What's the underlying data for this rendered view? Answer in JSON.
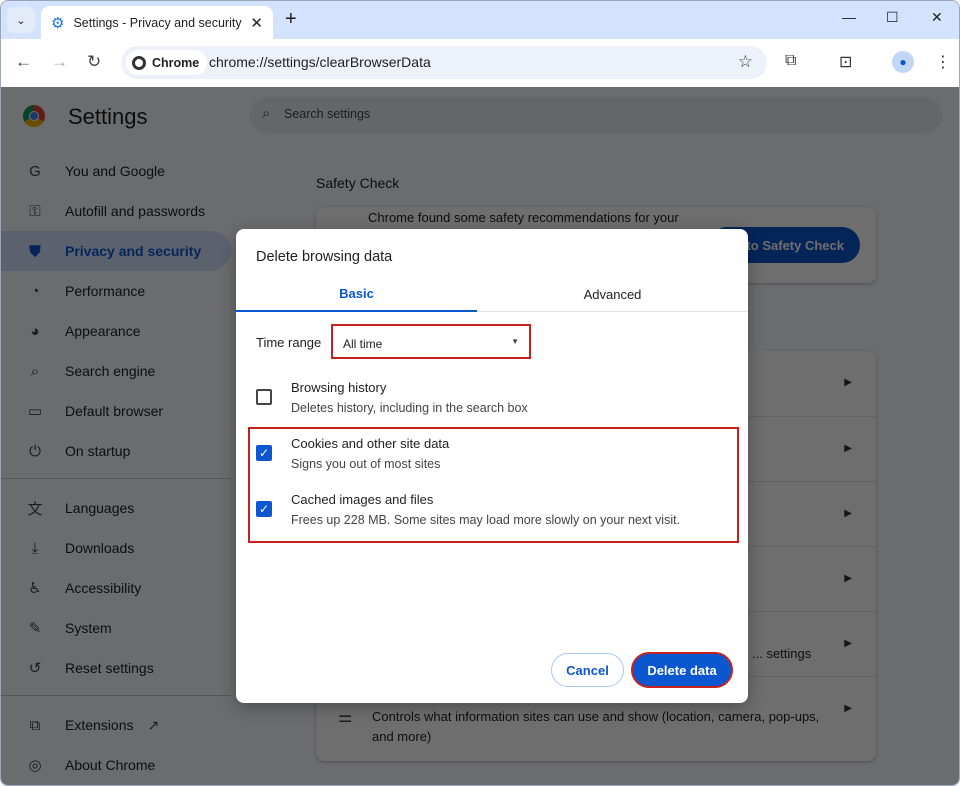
{
  "browser": {
    "tab_title": "Settings - Privacy and security",
    "chip_label": "Chrome",
    "url": "chrome://settings/clearBrowserData"
  },
  "settings": {
    "title": "Settings",
    "search_placeholder": "Search settings",
    "sidebar": [
      {
        "label": "You and Google",
        "icon": "google-icon"
      },
      {
        "label": "Autofill and passwords",
        "icon": "key-icon"
      },
      {
        "label": "Privacy and security",
        "icon": "shield-icon",
        "active": true
      },
      {
        "label": "Performance",
        "icon": "speedometer-icon"
      },
      {
        "label": "Appearance",
        "icon": "palette-icon"
      },
      {
        "label": "Search engine",
        "icon": "search-icon"
      },
      {
        "label": "Default browser",
        "icon": "browser-icon"
      },
      {
        "label": "On startup",
        "icon": "power-icon"
      },
      {
        "label": "Languages",
        "icon": "translate-icon"
      },
      {
        "label": "Downloads",
        "icon": "download-icon"
      },
      {
        "label": "Accessibility",
        "icon": "accessibility-icon"
      },
      {
        "label": "System",
        "icon": "wrench-icon"
      },
      {
        "label": "Reset settings",
        "icon": "reset-icon"
      },
      {
        "label": "Extensions",
        "icon": "puzzle-icon"
      },
      {
        "label": "About Chrome",
        "icon": "chrome-icon"
      }
    ],
    "safety_check": {
      "heading": "Safety Check",
      "text": "Chrome found some safety recommendations for your",
      "button": "Go to Safety Check"
    },
    "rows": [
      {
        "text": "... settings"
      },
      {
        "text": "Controls what information sites can use and show (location, camera, pop-ups, and more)"
      }
    ]
  },
  "dialog": {
    "title": "Delete browsing data",
    "tabs": [
      {
        "label": "Basic",
        "selected": true
      },
      {
        "label": "Advanced",
        "selected": false
      }
    ],
    "time_range_label": "Time range",
    "time_range_value": "All time",
    "items": [
      {
        "title": "Browsing history",
        "subtitle": "Deletes history, including in the search box",
        "checked": false
      },
      {
        "title": "Cookies and other site data",
        "subtitle": "Signs you out of most sites",
        "checked": true
      },
      {
        "title": "Cached images and files",
        "subtitle": "Frees up 228 MB. Some sites may load more slowly on your next visit.",
        "checked": true
      }
    ],
    "cancel": "Cancel",
    "delete": "Delete data"
  },
  "colors": {
    "accent": "#0b57d0",
    "highlight": "#c5221f",
    "tabstrip": "#d3e3fd"
  }
}
